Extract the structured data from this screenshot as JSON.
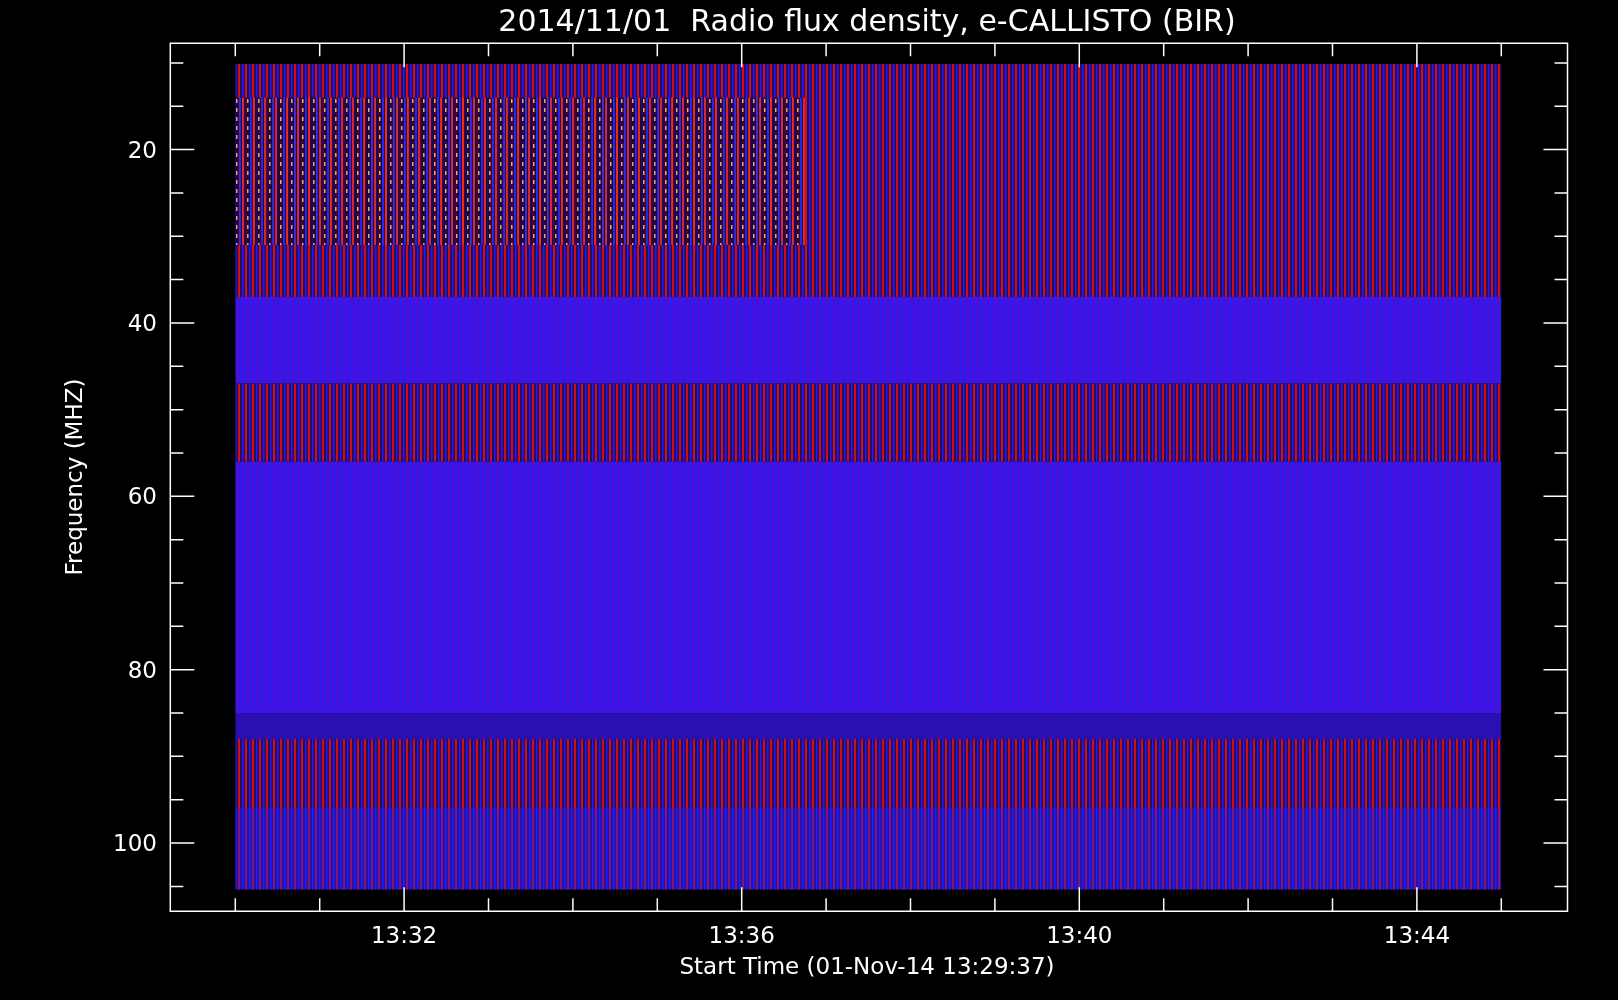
{
  "plot": {
    "title": "2014/11/01  Radio flux density, e-CALLISTO (BIR)",
    "ylabel": "Frequency (MHZ)",
    "xlabel": "Start Time (01-Nov-14 13:29:37)",
    "yticks": [
      "20",
      "40",
      "60",
      "80",
      "100"
    ],
    "xticks": [
      "13:32",
      "13:36",
      "13:40",
      "13:44"
    ]
  }
}
